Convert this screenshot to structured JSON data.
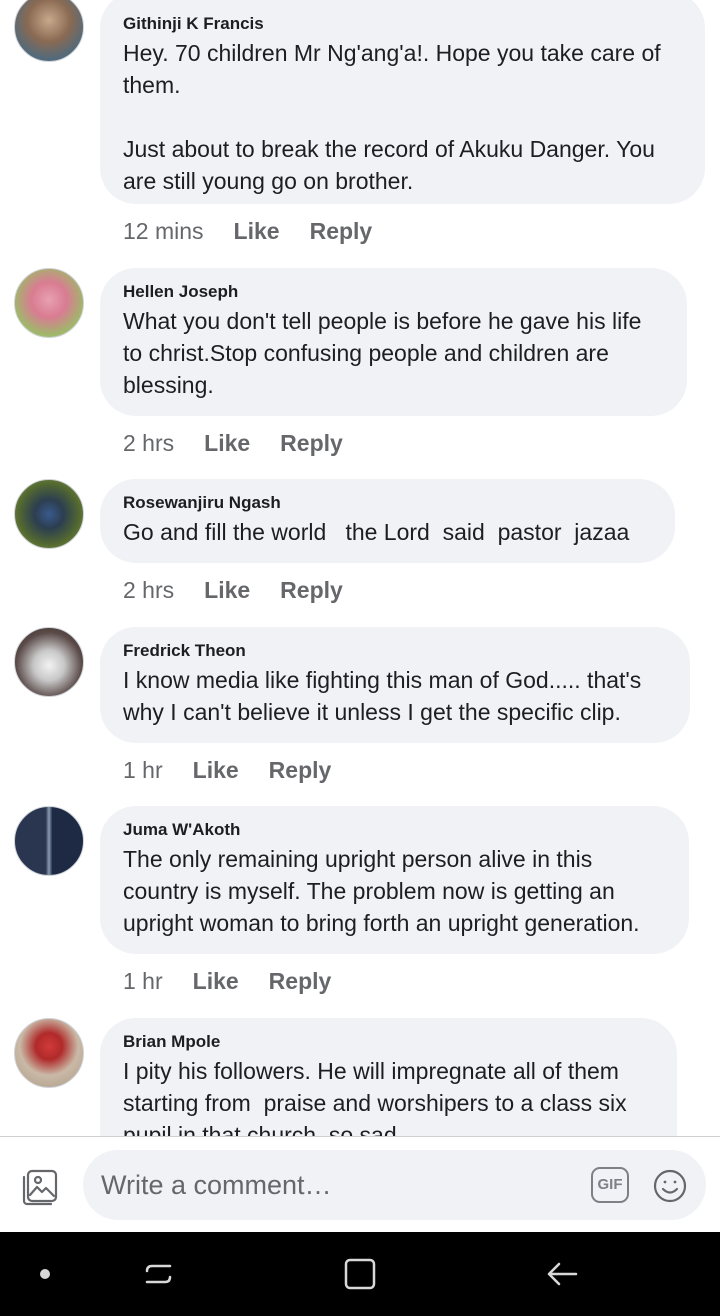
{
  "comments": [
    {
      "author": "Githinji K Francis",
      "text": "Hey. 70 children Mr Ng'ang'a!. Hope you take care of\nthem.\n\nJust about to break the record of Akuku Danger. You\nare still young go on brother.",
      "time": "12 mins",
      "like_label": "Like",
      "reply_label": "Reply"
    },
    {
      "author": "Hellen Joseph",
      "text": "What you don't tell people is before he gave his life\nto christ.Stop confusing people and children are\nblessing.",
      "time": "2 hrs",
      "like_label": "Like",
      "reply_label": "Reply"
    },
    {
      "author": "Rosewanjiru Ngash",
      "text": "Go and fill the world   the Lord  said  pastor  jazaa",
      "time": "2 hrs",
      "like_label": "Like",
      "reply_label": "Reply"
    },
    {
      "author": "Fredrick Theon",
      "text": "I know media like fighting this man of God..... that's\nwhy I can't believe it unless I get the specific clip.",
      "time": "1 hr",
      "like_label": "Like",
      "reply_label": "Reply"
    },
    {
      "author": "Juma W'Akoth",
      "text": "The only remaining upright person alive in this\ncountry is myself. The problem now is getting an\nupright woman to bring forth an upright generation.",
      "time": "1 hr",
      "like_label": "Like",
      "reply_label": "Reply"
    },
    {
      "author": "Brian Mpole",
      "text": "I pity his followers. He will impregnate all of them\nstarting from  praise and worshipers to a class six\npupil in that church, so sad",
      "time": "",
      "like_label": "",
      "reply_label": ""
    }
  ],
  "composer": {
    "placeholder": "Write a comment…",
    "gif_label": "GIF",
    "photo_icon": "photo-icon",
    "emoji_icon": "emoji-icon"
  },
  "navbar": {
    "icons": [
      "dot-icon",
      "recent-apps-icon",
      "home-icon",
      "back-icon"
    ]
  },
  "colors": {
    "bubble": "#f0f2f5",
    "secondary_text": "#65676b",
    "navbar": "#000000"
  }
}
